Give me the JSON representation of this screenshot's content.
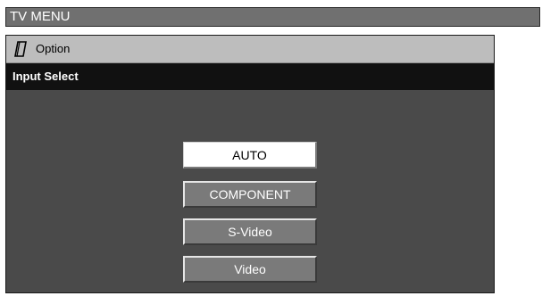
{
  "header": {
    "title": "TV MENU"
  },
  "menu": {
    "category": "Option",
    "category_icon": "note-icon",
    "section_title": "Input Select"
  },
  "inputs": {
    "options": [
      "AUTO",
      "COMPONENT",
      "S-Video",
      "Video"
    ],
    "selected": "AUTO"
  },
  "colors": {
    "panel": "#4a4a4a",
    "section_bar": "#111111",
    "selected_button": "#ffffff",
    "button": "#7a7a7a"
  }
}
